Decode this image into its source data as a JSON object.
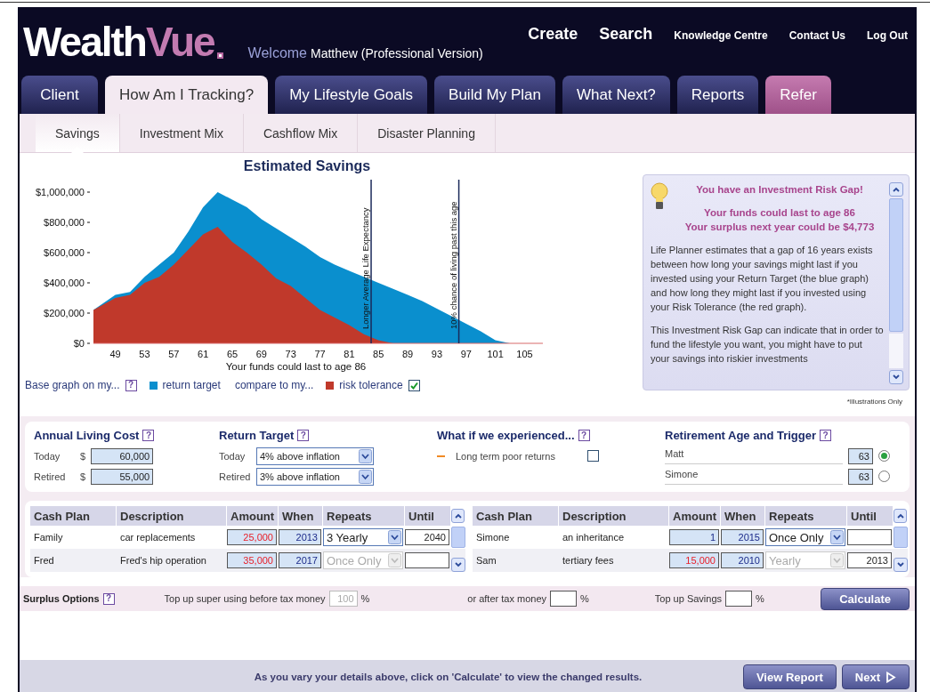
{
  "brand": {
    "logo": [
      "Wealth",
      "Vue"
    ],
    "welcome": "Welcome",
    "user": "Matthew (Professional Version)"
  },
  "top_links": [
    {
      "label": "Create",
      "kind": "large"
    },
    {
      "label": "Search",
      "kind": "large"
    },
    {
      "label": "Knowledge Centre",
      "kind": "small"
    },
    {
      "label": "Contact Us",
      "kind": "small"
    },
    {
      "label": "Log Out",
      "kind": "small"
    }
  ],
  "tabs": [
    {
      "label": "Client",
      "selected": false,
      "kind": "normal"
    },
    {
      "label": "How Am I Tracking?",
      "selected": true,
      "kind": "normal"
    },
    {
      "label": "My Lifestyle Goals",
      "selected": false,
      "kind": "normal"
    },
    {
      "label": "Build My Plan",
      "selected": false,
      "kind": "normal"
    },
    {
      "label": "What Next?",
      "selected": false,
      "kind": "normal"
    },
    {
      "label": "Reports",
      "selected": false,
      "kind": "normal"
    },
    {
      "label": "Refer",
      "selected": false,
      "kind": "highlight"
    }
  ],
  "subtabs": [
    {
      "label": "Savings",
      "selected": true
    },
    {
      "label": "Investment Mix",
      "selected": false
    },
    {
      "label": "Cashflow Mix",
      "selected": false
    },
    {
      "label": "Disaster Planning",
      "selected": false
    }
  ],
  "chart": {
    "chart_data": {
      "type": "area",
      "title": "Estimated Savings",
      "xlabel": "Your funds could last to age 86",
      "x": [
        46,
        49,
        51,
        53,
        55,
        57,
        59,
        61,
        63,
        65,
        67,
        69,
        71,
        73,
        75,
        77,
        79,
        81,
        83,
        85,
        87,
        89,
        91,
        93,
        95,
        97,
        99,
        101,
        103,
        105,
        107
      ],
      "series": [
        {
          "name": "return target",
          "color": "#0a8fce",
          "values": [
            220000,
            320000,
            340000,
            440000,
            520000,
            600000,
            740000,
            900000,
            1000000,
            950000,
            900000,
            820000,
            760000,
            700000,
            640000,
            570000,
            520000,
            480000,
            440000,
            400000,
            360000,
            320000,
            280000,
            230000,
            180000,
            130000,
            80000,
            20000,
            0,
            0,
            0
          ]
        },
        {
          "name": "risk tolerance",
          "color": "#c0392b",
          "values": [
            220000,
            300000,
            320000,
            400000,
            440000,
            520000,
            620000,
            720000,
            770000,
            670000,
            600000,
            520000,
            430000,
            380000,
            300000,
            220000,
            170000,
            120000,
            60000,
            20000,
            0,
            0,
            0,
            0,
            0,
            0,
            0,
            0,
            0,
            0,
            0
          ]
        }
      ],
      "xlim": [
        46,
        107.5
      ],
      "ylim": [
        0,
        1000000
      ],
      "xticks": [
        49,
        53,
        57,
        61,
        65,
        69,
        73,
        77,
        81,
        85,
        89,
        93,
        97,
        101,
        105
      ],
      "yticks": [
        {
          "value": 0,
          "label": "$0"
        },
        {
          "value": 200000,
          "label": "$200,000"
        },
        {
          "value": 400000,
          "label": "$400,000"
        },
        {
          "value": 600000,
          "label": "$600,000"
        },
        {
          "value": 800000,
          "label": "$800,000"
        },
        {
          "value": 1000000,
          "label": "$1,000,000"
        }
      ],
      "stacked": false,
      "ref_lines": [
        {
          "axis": "x",
          "value": 84,
          "label": "Longer Average Life Expectancy"
        },
        {
          "axis": "x",
          "value": 96,
          "label": "10% chance of living past this age"
        }
      ]
    }
  },
  "legend": {
    "base_label": "Base graph on my...",
    "help": "?",
    "compare_label": "compare to my...",
    "compare_checked": true
  },
  "info_panel": {
    "heading": "You have an Investment Risk Gap!",
    "summary": [
      "Your funds could last to age 86",
      "Your surplus next year could be $4,773"
    ],
    "paragraphs": [
      "Life Planner estimates that a gap of 16 years exists between how long your savings might last if you invested using your Return Target (the blue graph) and how long they might last if you invested using your Risk Tolerance (the red graph).",
      "This Investment Risk Gap can indicate that in order to fund the lifestyle you want, you might have to put your savings into riskier investments"
    ]
  },
  "illustration_note": "*Illustrations Only",
  "living_cost": {
    "title": "Annual Living Cost",
    "help": "?",
    "rows": [
      {
        "label": "Today",
        "currency": "$",
        "value": "60,000"
      },
      {
        "label": "Retired",
        "currency": "$",
        "value": "55,000"
      }
    ]
  },
  "return_target": {
    "title": "Return Target",
    "help": "?",
    "rows": [
      {
        "label": "Today",
        "value": "4% above inflation"
      },
      {
        "label": "Retired",
        "value": "3% above inflation"
      }
    ]
  },
  "scenario": {
    "title": "What if we experienced...",
    "help": "?",
    "options": [
      {
        "label": "Long term poor returns",
        "checked": false
      }
    ]
  },
  "retirement": {
    "title": "Retirement Age and Trigger",
    "help": "?",
    "people": [
      {
        "name": "Matt",
        "age": "63",
        "selected": true
      },
      {
        "name": "Simone",
        "age": "63",
        "selected": false
      }
    ]
  },
  "cash_plans": [
    {
      "columns": [
        "Cash Plan",
        "Description",
        "Amount",
        "When",
        "Repeats",
        "Until"
      ],
      "rows": [
        {
          "plan": "Family",
          "description": "car replacements",
          "amount": "25,000",
          "flagged": true,
          "when": "2013",
          "repeats": "3 Yearly",
          "repeats_disabled": false,
          "until": "2040"
        },
        {
          "plan": "Fred",
          "description": "Fred's hip operation",
          "amount": "35,000",
          "flagged": true,
          "when": "2017",
          "repeats": "Once Only",
          "repeats_disabled": true
        }
      ]
    },
    {
      "columns": [
        "Cash Plan",
        "Description",
        "Amount",
        "When",
        "Repeats",
        "Until"
      ],
      "rows": [
        {
          "plan": "Simone",
          "description": "an inheritance",
          "amount": "1",
          "flagged": false,
          "when": "2015",
          "repeats": "Once Only",
          "repeats_disabled": false
        },
        {
          "plan": "Sam",
          "description": "tertiary fees",
          "amount": "15,000",
          "flagged": true,
          "when": "2010",
          "repeats": "Yearly",
          "repeats_disabled": true,
          "until": "2013"
        }
      ]
    }
  ],
  "surplus": {
    "title": "Surplus Options",
    "help": "?",
    "fields": [
      {
        "label": "Top up super using before tax money",
        "value": "100",
        "unit": "%",
        "disabled": true
      },
      {
        "label": "or after tax money",
        "unit": "%",
        "disabled": false
      },
      {
        "label": "Top up Savings",
        "unit": "%",
        "disabled": false
      }
    ],
    "button": "Calculate"
  },
  "footer": {
    "message": "As you vary your details above, click on 'Calculate' to view the changed results.",
    "buttons": [
      {
        "label": "View Report",
        "kind": "plain"
      },
      {
        "label": "Next",
        "kind": "next"
      }
    ]
  }
}
